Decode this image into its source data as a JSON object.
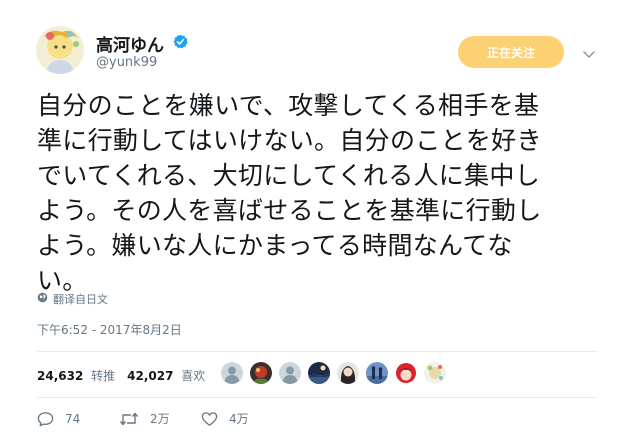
{
  "user": {
    "display_name": "高河ゆん",
    "handle": "@yunk99",
    "verified": true
  },
  "follow_button": {
    "label": "正在关注"
  },
  "tweet": {
    "lines": [
      "自分のことを嫌いで、攻撃してくる相手を基",
      "準に行動してはいけない。自分のことを好き",
      "でいてくれる、大切にしてくれる人に集中し",
      "よう。その人を喜ばせることを基準に行動し",
      "よう。嫌いな人にかまってる時間なんてな",
      "い。"
    ]
  },
  "translate_link": "翻译自日文",
  "timestamp": "下午6:52 - 2017年8月2日",
  "stats": {
    "retweets_count": "24,632",
    "retweets_label": "转推",
    "likes_count": "42,027",
    "likes_label": "喜欢"
  },
  "likers": [
    {
      "icon": "default-avatar"
    },
    {
      "icon": "user-avatar-red"
    },
    {
      "icon": "default-avatar"
    },
    {
      "icon": "user-avatar-night"
    },
    {
      "icon": "user-avatar-girl"
    },
    {
      "icon": "user-avatar-blue"
    },
    {
      "icon": "user-avatar-redhair"
    },
    {
      "icon": "user-avatar-light"
    }
  ],
  "actions": {
    "reply_count": "74",
    "retweet_count": "2万",
    "like_count": "4万"
  },
  "colors": {
    "follow_button_bg": "#fbd173",
    "verified_blue": "#1da1f2",
    "muted_text": "#657786"
  }
}
